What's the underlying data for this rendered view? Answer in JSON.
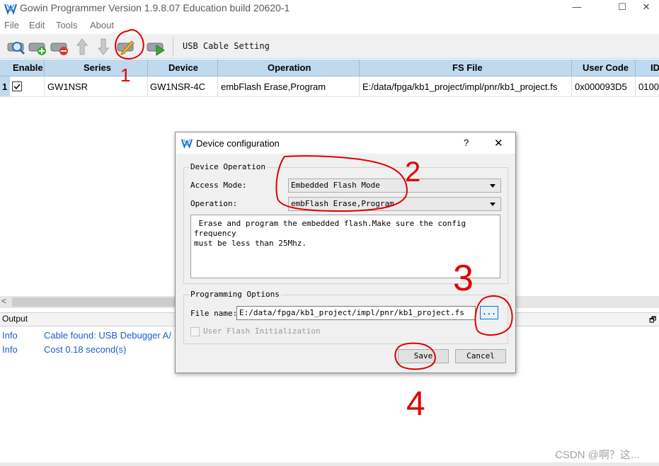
{
  "window": {
    "title": "Gowin Programmer Version 1.9.8.07 Education build 20620-1",
    "minimize_glyph": "—",
    "maximize_glyph": "☐",
    "close_glyph": "✕"
  },
  "menu": [
    "File",
    "Edit",
    "Tools",
    "About"
  ],
  "toolbar": {
    "icons": [
      "scan-device-icon",
      "add-device-icon",
      "remove-device-icon",
      "move-up-icon",
      "move-down-icon",
      "config-device-icon",
      "program-device-icon"
    ],
    "usb_cable_setting": "USB Cable Setting"
  },
  "table": {
    "columns": [
      "Enable",
      "Series",
      "Device",
      "Operation",
      "FS File",
      "User Code",
      "ID"
    ],
    "rows": [
      {
        "index": "1",
        "enabled": true,
        "series": "GW1NSR",
        "device": "GW1NSR-4C",
        "operation": "embFlash Erase,Program",
        "fs_file": "E:/data/fpga/kb1_project/impl/pnr/kb1_project.fs",
        "user_code": "0x000093D5",
        "id": "0100"
      }
    ]
  },
  "scrollbar": {
    "left_arrow": "<"
  },
  "output": {
    "title": "Output",
    "float_glyph": "🗗",
    "lines": [
      {
        "level": "Info",
        "message": "Cable found:  USB Debugger A/"
      },
      {
        "level": "Info",
        "message": "Cost 0.18 second(s)"
      }
    ]
  },
  "dialog": {
    "title": "Device configuration",
    "help_glyph": "?",
    "close_glyph": "✕",
    "device_operation_group": "Device Operation",
    "access_mode_label": "Access Mode:",
    "access_mode_value": "Embedded Flash Mode",
    "operation_label": "Operation:",
    "operation_value": "embFlash Erase,Program",
    "description": " Erase and program the embedded flash.Make sure the config frequency\nmust be less than 25Mhz.",
    "programming_options_group": "Programming Options",
    "file_name_label": "File name:",
    "file_name_value": "E:/data/fpga/kb1_project/impl/pnr/kb1_project.fs",
    "browse_label": "...",
    "user_flash_init_label": "User Flash Initialization",
    "user_flash_init_checked": false,
    "save_label": "Save",
    "cancel_label": "Cancel"
  },
  "annotations": [
    "1",
    "2",
    "3",
    "4"
  ],
  "watermark": "CSDN @啊？这...",
  "colors": {
    "header_bg": "#bfd9ef",
    "info_text": "#1a5fd0",
    "annotation": "#e00000",
    "browse_focus": "#0078d7"
  }
}
